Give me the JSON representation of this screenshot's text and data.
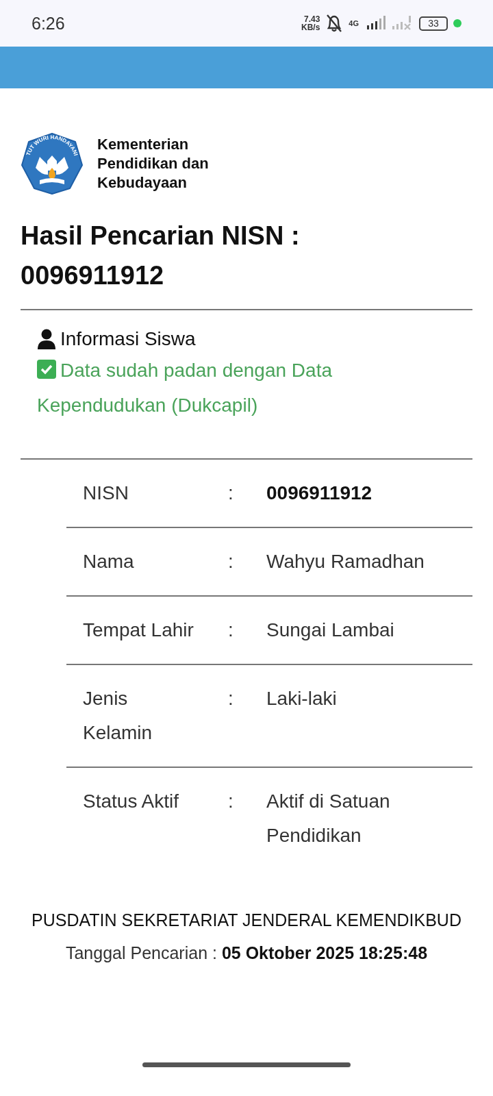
{
  "status_bar": {
    "time": "6:26",
    "speed_value": "7.43",
    "speed_unit": "KB/s",
    "network": "4G",
    "battery": "33"
  },
  "header": {
    "logo_motto": "TUT WURI HANDAYANI",
    "org_name": "Kementerian Pendidikan dan Kebudayaan"
  },
  "title": "Hasil Pencarian NISN : 0096911912",
  "section": {
    "heading": "Informasi Siswa",
    "verified": true,
    "verified_text": "Data sudah padan dengan Data Kependudukan (Dukcapil)"
  },
  "rows": [
    {
      "label": "NISN",
      "separator": ":",
      "value": "0096911912",
      "bold": true
    },
    {
      "label": "Nama",
      "separator": ":",
      "value": "Wahyu Ramadhan",
      "bold": false
    },
    {
      "label": "Tempat Lahir",
      "separator": ":",
      "value": "Sungai Lambai",
      "bold": false
    },
    {
      "label": "Jenis Kelamin",
      "separator": ":",
      "value": "Laki-laki",
      "bold": false
    },
    {
      "label": "Status Aktif",
      "separator": ":",
      "value": "Aktif di Satuan Pendidikan",
      "bold": false
    }
  ],
  "footer": {
    "agency": "PUSDATIN SEKRETARIAT JENDERAL KEMENDIKBUD",
    "search_date": "Tanggal Pencarian : **05 Oktober 2025 18:25:48**"
  }
}
